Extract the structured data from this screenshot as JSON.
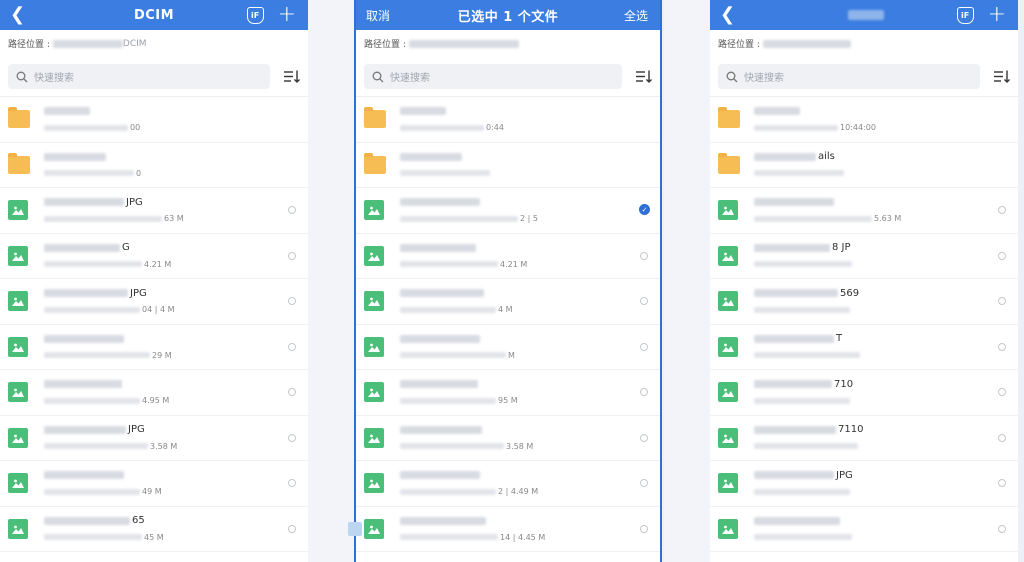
{
  "colors": {
    "accent": "#3b7de0",
    "folder": "#f7bd55",
    "image_icon": "#4bbf7a",
    "selected": "#2f6fd6"
  },
  "panels": [
    {
      "id": "p1",
      "header": {
        "left_icon": "chevron-left-icon",
        "title": "DCIM",
        "right_icons": [
          "shield-icon",
          "plus-icon"
        ],
        "shield_text": "iF"
      },
      "path_label": "路径位置 :",
      "path_value": "DCIM",
      "search_placeholder": "快速搜索",
      "rows": [
        {
          "type": "folder",
          "name_tail": "",
          "info_tail": "00",
          "checked": false
        },
        {
          "type": "folder",
          "name_tail": "",
          "info_tail": "0",
          "checked": false
        },
        {
          "type": "image",
          "name_tail": "JPG",
          "info_tail": "63 M",
          "checked": false
        },
        {
          "type": "image",
          "name_tail": "G",
          "info_tail": "4.21 M",
          "checked": false
        },
        {
          "type": "image",
          "name_tail": "JPG",
          "info_tail": "04 | 4 M",
          "checked": false
        },
        {
          "type": "image",
          "name_tail": "",
          "info_tail": "29 M",
          "checked": false
        },
        {
          "type": "image",
          "name_tail": "",
          "info_tail": "4.95 M",
          "checked": false
        },
        {
          "type": "image",
          "name_tail": "JPG",
          "info_tail": "3.58 M",
          "checked": false
        },
        {
          "type": "image",
          "name_tail": "",
          "info_tail": "49 M",
          "checked": false
        },
        {
          "type": "image",
          "name_tail": "65",
          "info_tail": "45 M",
          "checked": false
        }
      ]
    },
    {
      "id": "p2",
      "header": {
        "left_text": "取消",
        "title": "已选中 1 个文件",
        "right_text": "全选"
      },
      "path_label": "路径位置 :",
      "path_value": "",
      "search_placeholder": "快速搜索",
      "rows": [
        {
          "type": "folder",
          "name_tail": "",
          "info_tail": "0:44",
          "checked": false
        },
        {
          "type": "folder",
          "name_tail": "",
          "info_tail": "",
          "checked": false
        },
        {
          "type": "image",
          "name_tail": "",
          "info_tail": "2 | 5",
          "checked": true
        },
        {
          "type": "image",
          "name_tail": "",
          "info_tail": "4.21 M",
          "checked": false
        },
        {
          "type": "image",
          "name_tail": "",
          "info_tail": "4 M",
          "checked": false
        },
        {
          "type": "image",
          "name_tail": "",
          "info_tail": "M",
          "checked": false
        },
        {
          "type": "image",
          "name_tail": "",
          "info_tail": "95 M",
          "checked": false
        },
        {
          "type": "image",
          "name_tail": "",
          "info_tail": "3.58 M",
          "checked": false
        },
        {
          "type": "image",
          "name_tail": "",
          "info_tail": "2 | 4.49 M",
          "checked": false
        },
        {
          "type": "image",
          "name_tail": "",
          "info_tail": "14 | 4.45 M",
          "checked": false
        }
      ]
    },
    {
      "id": "p3",
      "header": {
        "left_icon": "chevron-left-icon",
        "title": "",
        "right_icons": [
          "shield-icon",
          "plus-icon"
        ],
        "shield_text": "iF"
      },
      "path_label": "路径位置 :",
      "path_value": "",
      "search_placeholder": "快速搜索",
      "rows": [
        {
          "type": "folder",
          "name_tail": "",
          "info_tail": "10:44:00",
          "checked": false
        },
        {
          "type": "folder",
          "name_tail": "ails",
          "info_tail": "",
          "checked": false
        },
        {
          "type": "image",
          "name_tail": "",
          "info_tail": "5.63 M",
          "checked": false
        },
        {
          "type": "image",
          "name_tail": "8 JP",
          "info_tail": "",
          "checked": false
        },
        {
          "type": "image",
          "name_tail": "569",
          "info_tail": "",
          "checked": false
        },
        {
          "type": "image",
          "name_tail": "T",
          "info_tail": "",
          "checked": false
        },
        {
          "type": "image",
          "name_tail": "710",
          "info_tail": "",
          "checked": false
        },
        {
          "type": "image",
          "name_tail": "7110",
          "info_tail": "",
          "checked": false
        },
        {
          "type": "image",
          "name_tail": "JPG",
          "info_tail": "",
          "checked": false
        },
        {
          "type": "image",
          "name_tail": "",
          "info_tail": "",
          "checked": false
        }
      ]
    }
  ]
}
